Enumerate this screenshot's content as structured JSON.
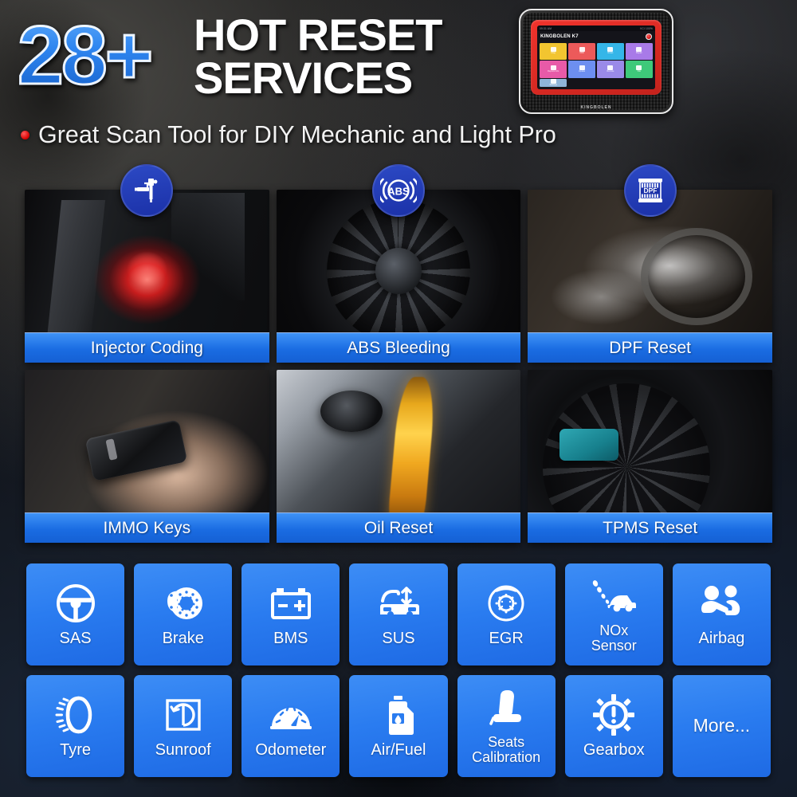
{
  "header": {
    "count": "28+",
    "headline_line1": "HOT RESET",
    "headline_line2": "SERVICES",
    "subtitle": "Great Scan Tool for DIY Mechanic and Light Pro"
  },
  "device": {
    "brand_model": "KINGBOLEN K7",
    "chin_brand": "KINGBOLEN",
    "status_left": "09:31 AM",
    "status_right": "VCI  100%",
    "apps": [
      {
        "label": "Diag",
        "color": "#f2c530",
        "icon": "diagnostics-icon"
      },
      {
        "label": "OBD",
        "color": "#ec5a5a",
        "icon": "obd-icon"
      },
      {
        "label": "Reset",
        "color": "#35b6e8",
        "icon": "reset-icon"
      },
      {
        "label": "Repair",
        "color": "#a87ae8",
        "icon": "repair-icon"
      },
      {
        "label": "Reports Info",
        "color": "#e85aa8",
        "icon": "reports-icon"
      },
      {
        "label": "Update",
        "color": "#6d8ff0",
        "icon": "update-icon"
      },
      {
        "label": "Remote",
        "color": "#9a8ae8",
        "icon": "remote-icon"
      },
      {
        "label": "File",
        "color": "#3ec97a",
        "icon": "file-icon"
      },
      {
        "label": "Settings",
        "color": "#8fb4d8",
        "icon": "settings-icon"
      }
    ]
  },
  "colors": {
    "accent_blue": "#2a7cf0",
    "label_bar_blue": "#1a6ce2",
    "badge_blue": "#1b31a8",
    "bullet_red": "#d40000"
  },
  "service_cards": [
    {
      "label": "Injector Coding",
      "badge_icon": "fuel-injector-icon",
      "scene": "ph-injector"
    },
    {
      "label": "ABS Bleeding",
      "badge_icon": "abs-warning-icon",
      "scene": "ph-abs"
    },
    {
      "label": "DPF Reset",
      "badge_icon": "dpf-filter-icon",
      "scene": "ph-dpf"
    },
    {
      "label": "IMMO Keys",
      "badge_icon": null,
      "scene": "ph-immo"
    },
    {
      "label": "Oil Reset",
      "badge_icon": null,
      "scene": "ph-oil"
    },
    {
      "label": "TPMS Reset",
      "badge_icon": null,
      "scene": "ph-tpms"
    }
  ],
  "function_tiles": [
    {
      "label": "SAS",
      "icon": "steering-wheel-icon",
      "two_line": false
    },
    {
      "label": "Brake",
      "icon": "brake-disc-icon",
      "two_line": false
    },
    {
      "label": "BMS",
      "icon": "battery-icon",
      "two_line": false
    },
    {
      "label": "SUS",
      "icon": "suspension-car-icon",
      "two_line": false
    },
    {
      "label": "EGR",
      "icon": "egr-valve-icon",
      "two_line": false
    },
    {
      "label": "NOx\nSensor",
      "icon": "nox-sensor-icon",
      "two_line": true
    },
    {
      "label": "Airbag",
      "icon": "airbag-seat-icon",
      "two_line": false
    },
    {
      "label": "Tyre",
      "icon": "tyre-icon",
      "two_line": false
    },
    {
      "label": "Sunroof",
      "icon": "sunroof-icon",
      "two_line": false
    },
    {
      "label": "Odometer",
      "icon": "odometer-gauge-icon",
      "two_line": false
    },
    {
      "label": "Air/Fuel",
      "icon": "air-fuel-jug-icon",
      "two_line": false
    },
    {
      "label": "Seats\nCalibration",
      "icon": "car-seat-icon",
      "two_line": true
    },
    {
      "label": "Gearbox",
      "icon": "gear-alert-icon",
      "two_line": false
    },
    {
      "label": "More...",
      "icon": null,
      "two_line": false
    }
  ]
}
